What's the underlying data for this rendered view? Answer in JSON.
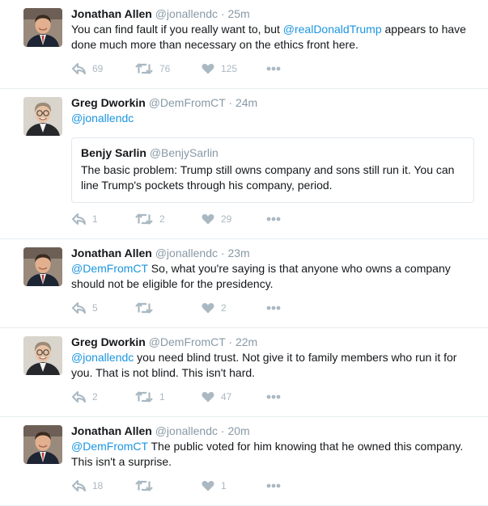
{
  "tweets": [
    {
      "author": "Jonathan Allen",
      "handle": "@jonallendc",
      "time": "25m",
      "text": [
        {
          "t": "You can find fault if you really want to, but "
        },
        {
          "t": "@realDonaldTrump",
          "link": true
        },
        {
          "t": " appears to have done much more than necessary on the ethics front here."
        }
      ],
      "replies": "69",
      "retweets": "76",
      "likes": "125",
      "avatar": "jonathan"
    },
    {
      "author": "Greg Dworkin",
      "handle": "@DemFromCT",
      "time": "24m",
      "text": [
        {
          "t": "@jonallendc",
          "link": true
        }
      ],
      "quote": {
        "author": "Benjy Sarlin",
        "handle": "@BenjySarlin",
        "text": "The basic problem: Trump still owns company and sons still run it. You can line Trump's pockets through his company, period."
      },
      "replies": "1",
      "retweets": "2",
      "likes": "29",
      "avatar": "greg"
    },
    {
      "author": "Jonathan Allen",
      "handle": "@jonallendc",
      "time": "23m",
      "text": [
        {
          "t": "@DemFromCT",
          "link": true
        },
        {
          "t": " So, what you're saying is that anyone who owns a company should not be eligible for the presidency."
        }
      ],
      "replies": "5",
      "retweets": "",
      "likes": "2",
      "avatar": "jonathan"
    },
    {
      "author": "Greg Dworkin",
      "handle": "@DemFromCT",
      "time": "22m",
      "text": [
        {
          "t": "@jonallendc",
          "link": true
        },
        {
          "t": " you need blind trust. Not give it to family members who run it for you. That is not blind. This isn't hard."
        }
      ],
      "replies": "2",
      "retweets": "1",
      "likes": "47",
      "avatar": "greg"
    },
    {
      "author": "Jonathan Allen",
      "handle": "@jonallendc",
      "time": "20m",
      "text": [
        {
          "t": "@DemFromCT",
          "link": true
        },
        {
          "t": " The public voted for him knowing that he owned this company. This isn't a surprise."
        }
      ],
      "replies": "18",
      "retweets": "",
      "likes": "1",
      "avatar": "jonathan"
    }
  ],
  "separator": "·",
  "icons": {
    "reply": "reply-icon",
    "retweet": "retweet-icon",
    "like": "heart-icon",
    "more": "more-icon"
  },
  "colors": {
    "link": "#1b95e0",
    "muted": "#8899a6",
    "action": "#aab8c2",
    "border": "#e6ecf0"
  }
}
